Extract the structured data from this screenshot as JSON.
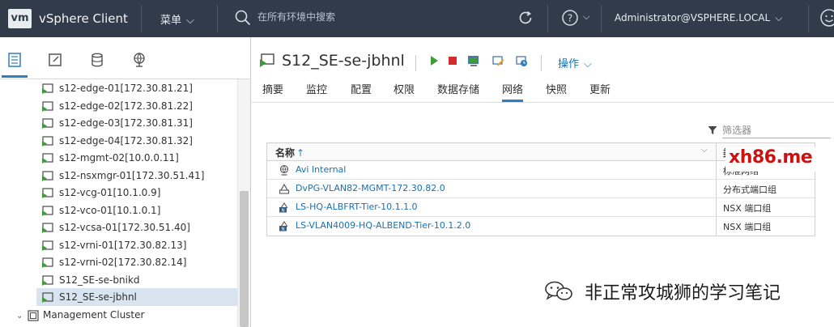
{
  "header": {
    "logo": "vm",
    "app_title": "vSphere Client",
    "menu_label": "菜单",
    "search_placeholder": "在所有环境中搜索",
    "user": "Administrator@VSPHERE.LOCAL"
  },
  "nav": {
    "tabs": [
      "hosts-clusters",
      "vms-templates",
      "storage",
      "networking"
    ],
    "items": [
      {
        "label": "s12-edge-01[172.30.81.21]"
      },
      {
        "label": "s12-edge-02[172.30.81.22]"
      },
      {
        "label": "s12-edge-03[172.30.81.31]"
      },
      {
        "label": "s12-edge-04[172.30.81.32]"
      },
      {
        "label": "s12-mgmt-02[10.0.0.11]"
      },
      {
        "label": "s12-nsxmgr-01[172.30.51.41]"
      },
      {
        "label": "s12-vcg-01[10.1.0.9]"
      },
      {
        "label": "s12-vco-01[10.1.0.1]"
      },
      {
        "label": "s12-vcsa-01[172.30.51.40]"
      },
      {
        "label": "s12-vrni-01[172.30.82.13]"
      },
      {
        "label": "s12-vrni-02[172.30.82.14]"
      },
      {
        "label": "S12_SE-se-bnikd"
      },
      {
        "label": "S12_SE-se-jbhnl"
      }
    ],
    "cluster_label": "Management Cluster"
  },
  "object": {
    "title": "S12_SE-se-jbhnl",
    "actions_label": "操作"
  },
  "tabs": [
    "摘要",
    "监控",
    "配置",
    "权限",
    "数据存储",
    "网络",
    "快照",
    "更新"
  ],
  "active_tab": "网络",
  "filter_placeholder": "筛选器",
  "table": {
    "col_name": "名称",
    "col_type": "类型",
    "rows": [
      {
        "name": "Avi Internal",
        "type": "标准网络"
      },
      {
        "name": "DvPG-VLAN82-MGMT-172.30.82.0",
        "type": "分布式端口组"
      },
      {
        "name": "LS-HQ-ALBFRT-Tier-10.1.1.0",
        "type": "NSX 端口组"
      },
      {
        "name": "LS-VLAN4009-HQ-ALBEND-Tier-10.1.2.0",
        "type": "NSX 端口组"
      }
    ]
  },
  "watermarks": {
    "top": "xh86.me",
    "bottom": "非正常攻城狮的学习笔记"
  },
  "colors": {
    "header_bg": "#313b4a",
    "accent": "#2d7fbd",
    "link": "#1b6fae",
    "vm_icon_green": "#3f9b3a"
  }
}
